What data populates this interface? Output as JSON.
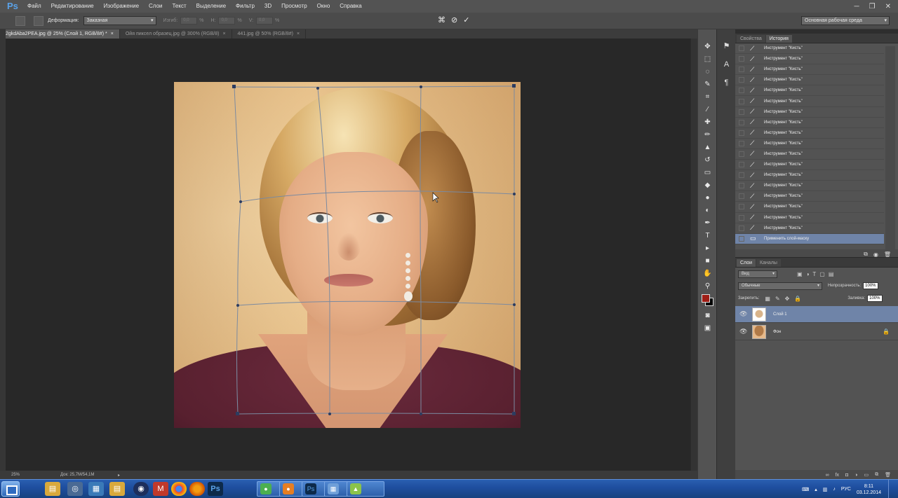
{
  "app": {
    "logo": "Ps"
  },
  "menu": [
    "Файл",
    "Редактирование",
    "Изображение",
    "Слои",
    "Текст",
    "Выделение",
    "Фильтр",
    "3D",
    "Просмотр",
    "Окно",
    "Справка"
  ],
  "window_controls": [
    "─",
    "❐",
    "✕"
  ],
  "options": {
    "warp_label": "Деформация:",
    "warp_value": "Заказная",
    "bend_label": "Изгиб:",
    "bend_value": "0,0",
    "h_label": "H:",
    "h_value": "0,0",
    "v_label": "V:",
    "v_value": "0,0",
    "pct": "%",
    "workspace": "Основная рабочая среда"
  },
  "doc_tabs": [
    {
      "title": "2gkdAba2PEA.jpg @ 25% (Слой 1, RGB/8#) *",
      "close": "×",
      "active": true
    },
    {
      "title": "Ойя пиксел образец.jpg @ 300% (RGB/8)",
      "close": "×",
      "active": false
    },
    {
      "title": "441.jpg @ 50% (RGB/8#)",
      "close": "×",
      "active": false
    }
  ],
  "status": {
    "zoom": "25%",
    "doc": "Док: 25,7M/54,1M",
    "arrow": "▸"
  },
  "history_panel": {
    "tabs": [
      "Свойства",
      "История"
    ],
    "items": [
      "Инструмент \"Кисть\"",
      "Инструмент \"Кисть\"",
      "Инструмент \"Кисть\"",
      "Инструмент \"Кисть\"",
      "Инструмент \"Кисть\"",
      "Инструмент \"Кисть\"",
      "Инструмент \"Кисть\"",
      "Инструмент \"Кисть\"",
      "Инструмент \"Кисть\"",
      "Инструмент \"Кисть\"",
      "Инструмент \"Кисть\"",
      "Инструмент \"Кисть\"",
      "Инструмент \"Кисть\"",
      "Инструмент \"Кисть\"",
      "Инструмент \"Кисть\"",
      "Инструмент \"Кисть\"",
      "Инструмент \"Кисть\"",
      "Инструмент \"Кисть\""
    ],
    "active_item": "Применить слой-маску"
  },
  "layers_panel": {
    "tabs": [
      "Слои",
      "Каналы"
    ],
    "filter": "Вид",
    "blend_mode": "Обычные",
    "opacity_label": "Непрозрачность:",
    "opacity": "100%",
    "lock_label": "Закрепить:",
    "fill_label": "Заливка:",
    "fill": "100%",
    "layers": [
      {
        "name": "Слой 1",
        "active": true
      },
      {
        "name": "Фон",
        "active": false,
        "locked": true
      }
    ]
  },
  "taskbar": {
    "clock_time": "8:11",
    "clock_date": "03.12.2014",
    "lang": "РУС"
  },
  "colors": {
    "foreground": "#9f1e16",
    "background": "#000000",
    "selection": "#6f84a8"
  }
}
